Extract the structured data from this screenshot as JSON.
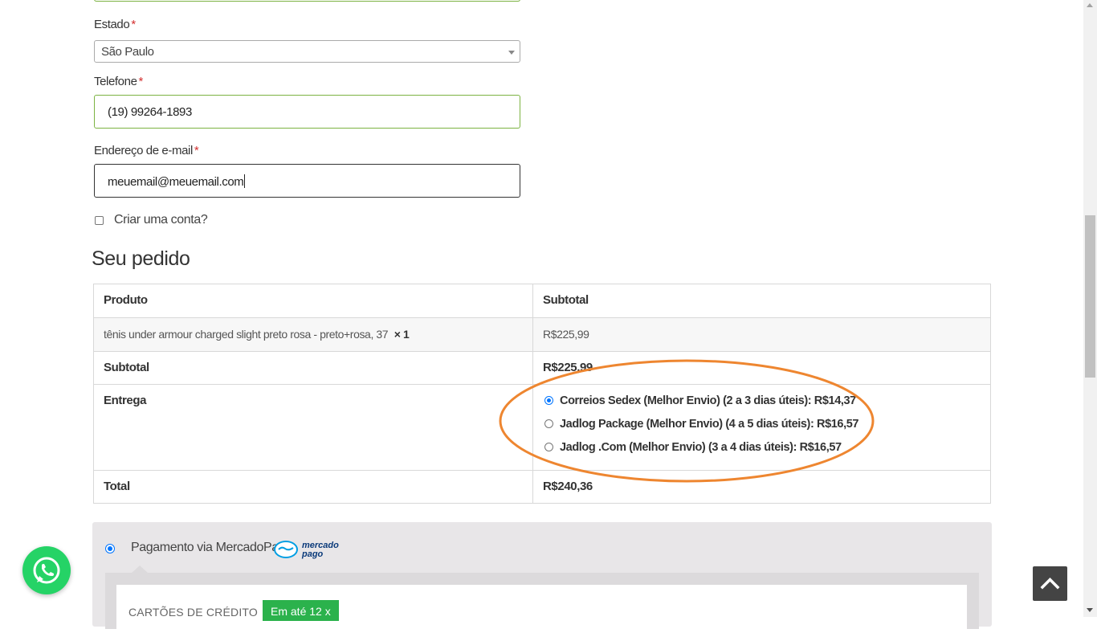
{
  "form": {
    "estado": {
      "label": "Estado",
      "required_mark": "*",
      "value": "São Paulo"
    },
    "telefone": {
      "label": "Telefone",
      "required_mark": "*",
      "value": "(19) 99264-1893"
    },
    "email": {
      "label": "Endereço de e-mail",
      "required_mark": "*",
      "value": "meuemail@meuemail.com"
    },
    "create_account": {
      "label": "Criar uma conta?",
      "checked": false
    }
  },
  "order": {
    "heading": "Seu pedido",
    "columns": {
      "product": "Produto",
      "subtotal": "Subtotal"
    },
    "item": {
      "name": "tênis under armour charged slight preto rosa - preto+rosa, 37",
      "qty": "× 1",
      "price": "R$225,99"
    },
    "subtotal": {
      "label": "Subtotal",
      "value": "R$225,99"
    },
    "shipping": {
      "label": "Entrega",
      "options": [
        {
          "text": "Correios Sedex (Melhor Envio) (2 a 3 dias úteis): R$14,37",
          "selected": true
        },
        {
          "text": "Jadlog Package (Melhor Envio) (4 a 5 dias úteis): R$16,57",
          "selected": false
        },
        {
          "text": "Jadlog .Com (Melhor Envio) (3 a 4 dias úteis): R$16,57",
          "selected": false
        }
      ]
    },
    "total": {
      "label": "Total",
      "value": "R$240,36"
    }
  },
  "payment": {
    "method_label": "Pagamento via MercadoPago",
    "logo_text_line1": "mercado",
    "logo_text_line2": "pago",
    "credit_cards_label": "CARTÕES DE CRÉDITO",
    "installments_badge": "Em até 12 x"
  },
  "icons": {
    "whatsapp": "whatsapp-icon",
    "back_to_top": "chevron-up-icon",
    "mercadopago": "mercadopago-logo"
  },
  "colors": {
    "annotation": "#ee8630",
    "whatsapp": "#25d366",
    "badge": "#2bb24c",
    "valid_border": "#7cb342",
    "required": "#d32f2f"
  }
}
